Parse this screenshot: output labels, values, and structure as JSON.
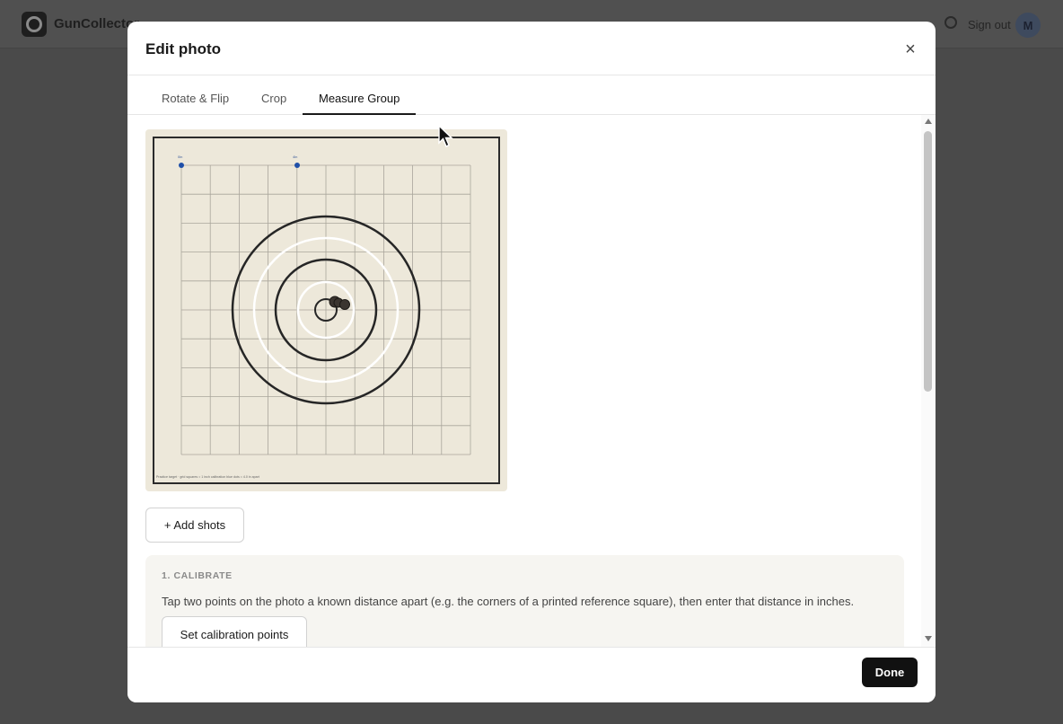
{
  "app": {
    "name": "GunCollector",
    "sign_out_label": "Sign out",
    "avatar_initial": "M"
  },
  "modal": {
    "title": "Edit photo",
    "close_symbol": "×",
    "tabs": [
      {
        "label": "Rotate & Flip",
        "active": false
      },
      {
        "label": "Crop",
        "active": false
      },
      {
        "label": "Measure Group",
        "active": true
      }
    ],
    "add_shots_label": "+ Add shots",
    "calibrate": {
      "step_label": "1. CALIBRATE",
      "instructions": "Tap two points on the photo a known distance apart (e.g. the corners of a printed reference square), then enter that distance in inches.",
      "button_label": "Set calibration points"
    },
    "done_label": "Done"
  },
  "target_photo": {
    "calibration_labels": [
      "0in",
      "4in"
    ],
    "caption": "Practice target · grid squares = 1 inch calibration blue dots = 4.0 in apart"
  },
  "icons": {
    "logo": "guncollector-logo-icon",
    "settings": "gear-icon",
    "close": "close-icon",
    "cursor": "mouse-pointer-icon"
  },
  "colors": {
    "primary_button": "#111111",
    "calibration_dot": "#1f4fa8",
    "target_paper": "#ede8da"
  }
}
